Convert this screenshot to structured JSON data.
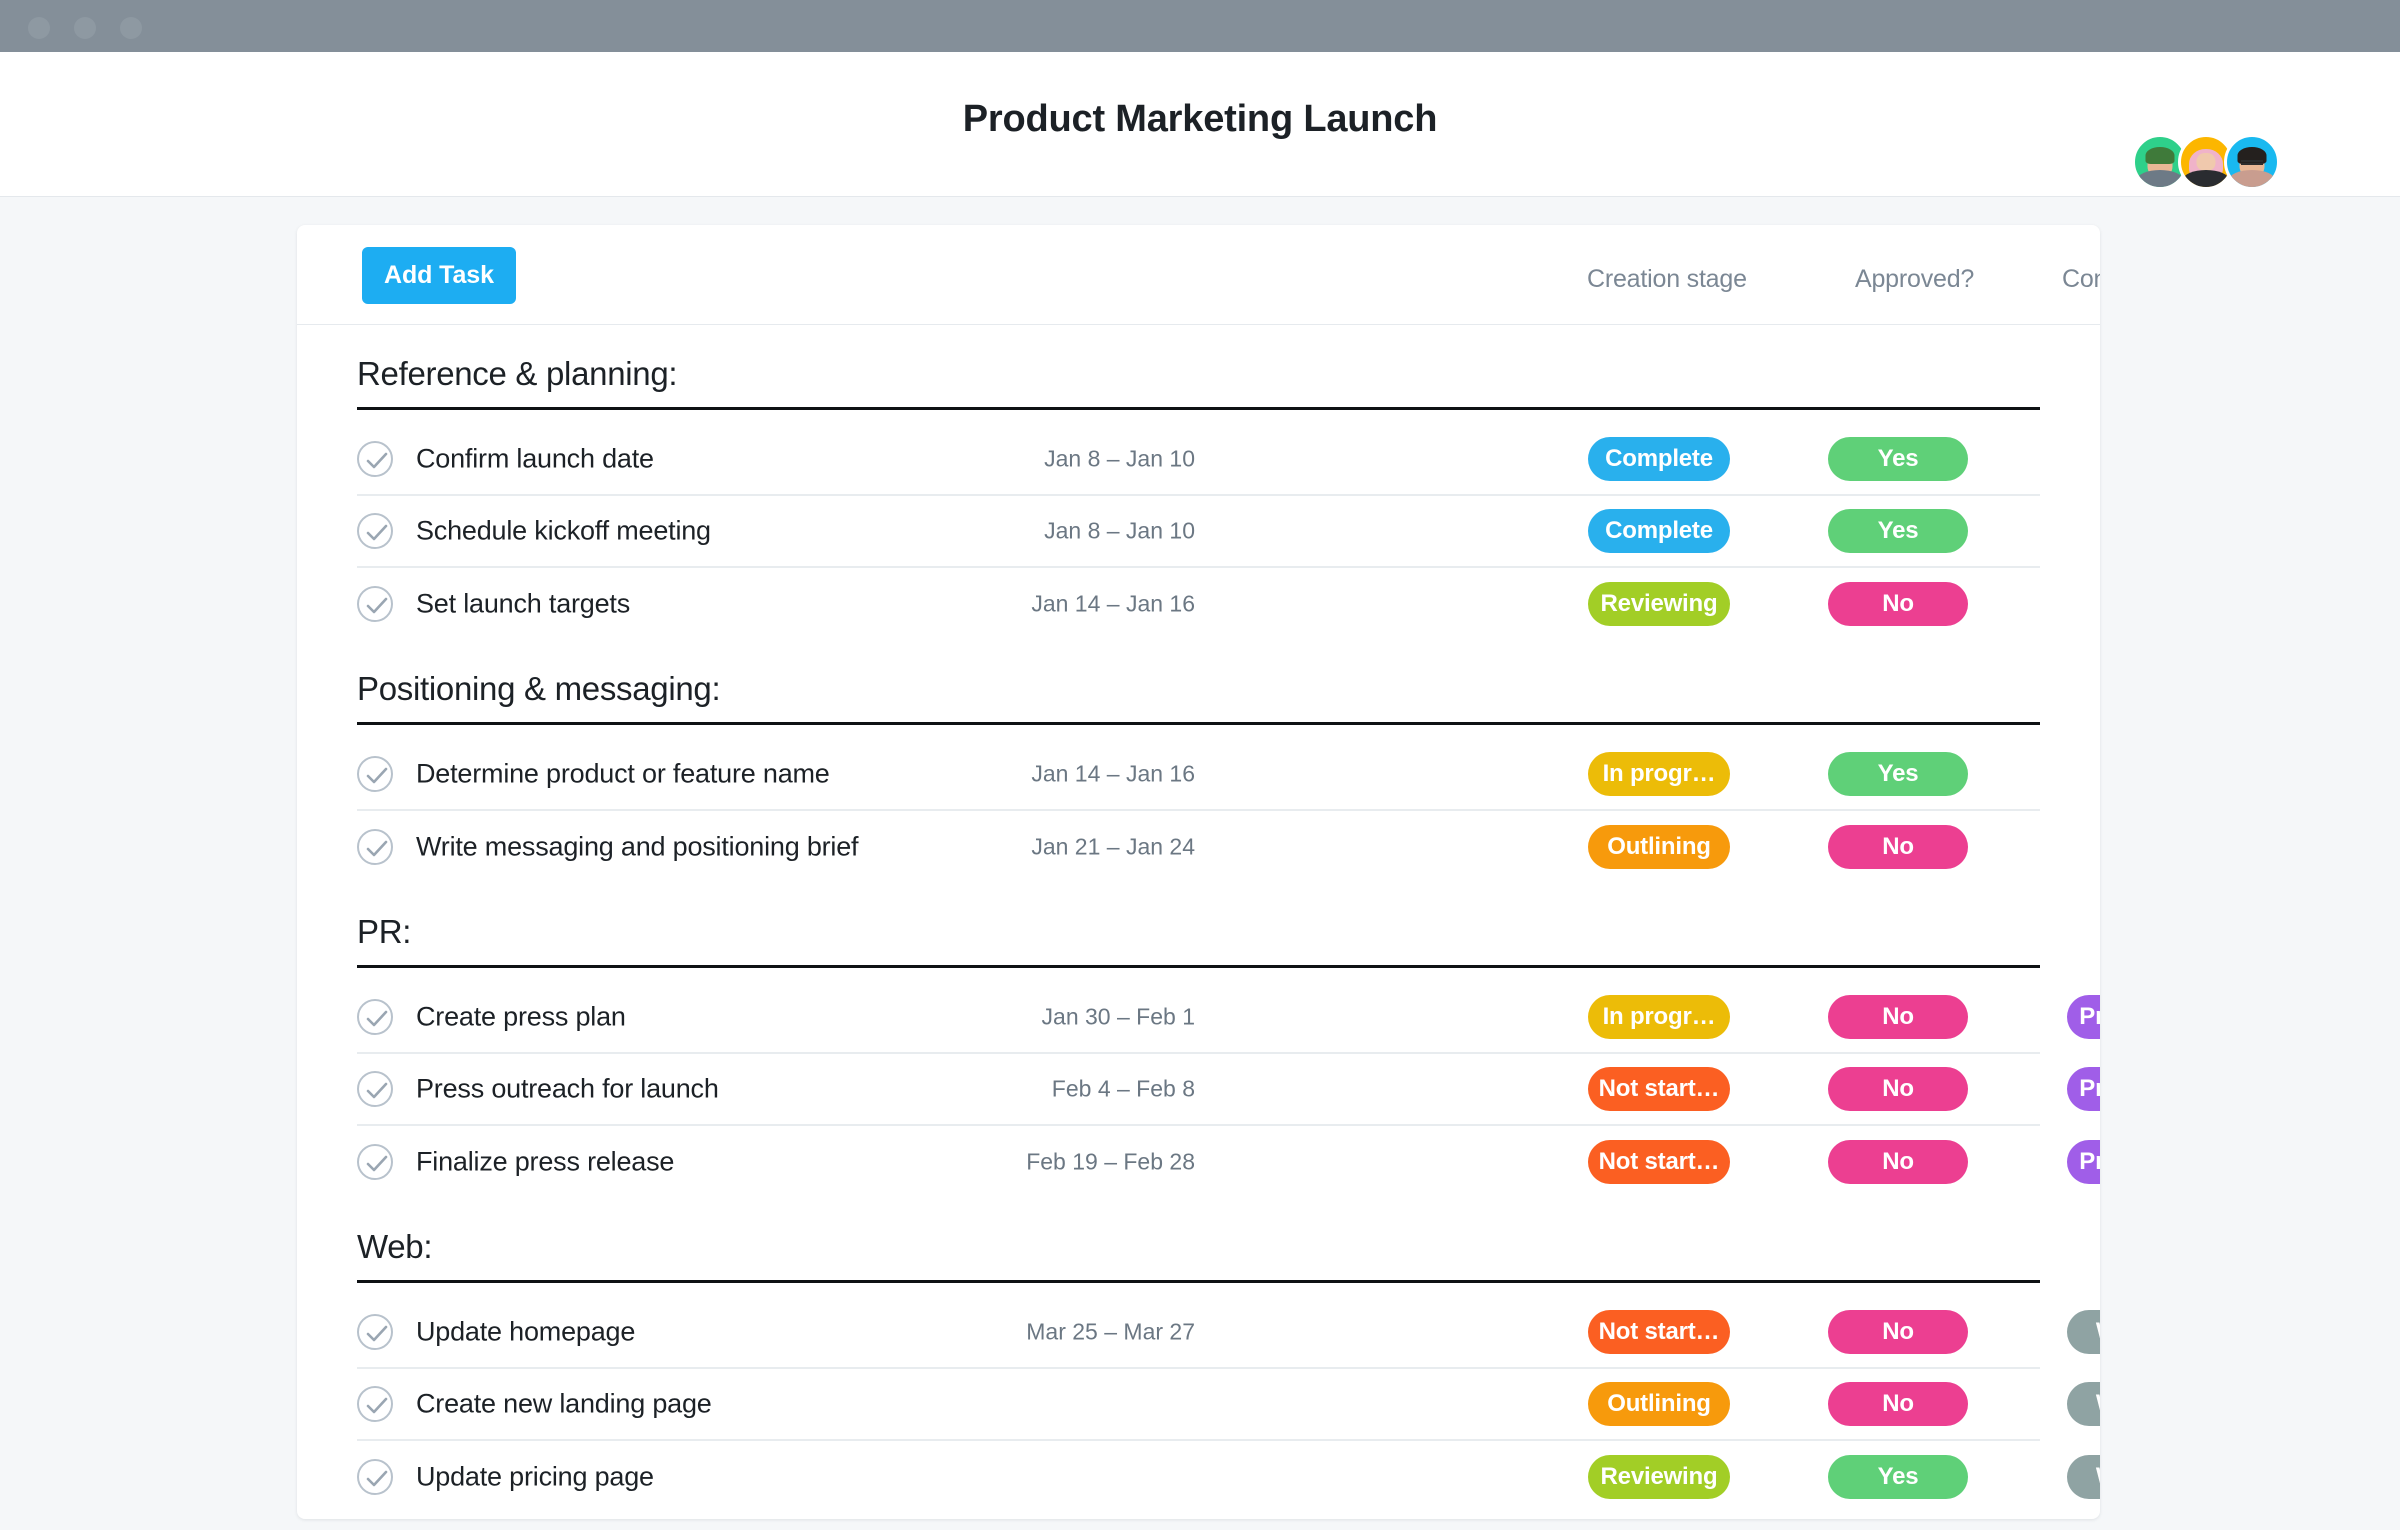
{
  "window": {
    "traffic_lights": [
      "close",
      "minimize",
      "maximize"
    ]
  },
  "header": {
    "title": "Product Marketing Launch",
    "avatars": [
      {
        "name": "team-member-green",
        "color": "#2ed08a",
        "tone": "green"
      },
      {
        "name": "team-member-yellow",
        "color": "#fcb600",
        "tone": "yellow"
      },
      {
        "name": "team-member-blue",
        "color": "#19b9f0",
        "tone": "blue"
      }
    ]
  },
  "toolbar": {
    "add_task_label": "Add Task",
    "columns": [
      {
        "key": "stage",
        "label": "Creation stage"
      },
      {
        "key": "approved",
        "label": "Approved?"
      },
      {
        "key": "channel",
        "label": "Content channel"
      }
    ]
  },
  "colors": {
    "accent": "#1dadf2",
    "complete": "#29b0ed",
    "reviewing": "#a2ce26",
    "in_progress": "#ecbc08",
    "outlining": "#f79a0c",
    "not_started": "#fb5f22",
    "yes": "#5fd078",
    "no": "#ec3f91",
    "press_release": "#a05ee8",
    "website": "#8fa3a3",
    "section_rule": "#0e1114",
    "window_bar": "#848f99"
  },
  "sections": [
    {
      "title": "Reference & planning:",
      "tasks": [
        {
          "name": "Confirm launch date",
          "dates": "Jan 8 – Jan 10",
          "stage": {
            "label": "Complete",
            "color": "#29b0ed"
          },
          "approved": {
            "label": "Yes",
            "color": "#5fd078"
          },
          "channel": null,
          "avatar": "yellow"
        },
        {
          "name": "Schedule kickoff meeting",
          "dates": "Jan 8 – Jan 10",
          "stage": {
            "label": "Complete",
            "color": "#29b0ed"
          },
          "approved": {
            "label": "Yes",
            "color": "#5fd078"
          },
          "channel": null,
          "avatar": "yellow"
        },
        {
          "name": "Set launch targets",
          "dates": "Jan 14 – Jan 16",
          "stage": {
            "label": "Reviewing",
            "color": "#a2ce26"
          },
          "approved": {
            "label": "No",
            "color": "#ec3f91"
          },
          "channel": null,
          "avatar": "yellow"
        }
      ]
    },
    {
      "title": "Positioning & messaging:",
      "tasks": [
        {
          "name": "Determine product or feature name",
          "dates": "Jan 14 – Jan 16",
          "stage": {
            "label": "In progr…",
            "color": "#ecbc08"
          },
          "approved": {
            "label": "Yes",
            "color": "#5fd078"
          },
          "channel": null,
          "avatar": "green"
        },
        {
          "name": "Write messaging and positioning brief",
          "dates": "Jan 21 – Jan 24",
          "stage": {
            "label": "Outlining",
            "color": "#f79a0c"
          },
          "approved": {
            "label": "No",
            "color": "#ec3f91"
          },
          "channel": null,
          "avatar": "green"
        }
      ]
    },
    {
      "title": "PR:",
      "tasks": [
        {
          "name": "Create press plan",
          "dates": "Jan 30 – Feb 1",
          "stage": {
            "label": "In progr…",
            "color": "#ecbc08"
          },
          "approved": {
            "label": "No",
            "color": "#ec3f91"
          },
          "channel": {
            "label": "Press rel…",
            "color": "#a05ee8"
          },
          "avatar": "green"
        },
        {
          "name": "Press outreach for launch",
          "dates": "Feb 4 – Feb 8",
          "stage": {
            "label": "Not start…",
            "color": "#fb5f22"
          },
          "approved": {
            "label": "No",
            "color": "#ec3f91"
          },
          "channel": {
            "label": "Press rel…",
            "color": "#a05ee8"
          },
          "avatar": "green"
        },
        {
          "name": "Finalize press release",
          "dates": "Feb 19 – Feb 28",
          "stage": {
            "label": "Not start…",
            "color": "#fb5f22"
          },
          "approved": {
            "label": "No",
            "color": "#ec3f91"
          },
          "channel": {
            "label": "Press rel…",
            "color": "#a05ee8"
          },
          "avatar": "yellow"
        }
      ]
    },
    {
      "title": "Web:",
      "tasks": [
        {
          "name": "Update homepage",
          "dates": "Mar 25 – Mar 27",
          "stage": {
            "label": "Not start…",
            "color": "#fb5f22"
          },
          "approved": {
            "label": "No",
            "color": "#ec3f91"
          },
          "channel": {
            "label": "Website",
            "color": "#8fa3a3"
          },
          "avatar": "green"
        },
        {
          "name": "Create new landing page",
          "dates": "",
          "stage": {
            "label": "Outlining",
            "color": "#f79a0c"
          },
          "approved": {
            "label": "No",
            "color": "#ec3f91"
          },
          "channel": {
            "label": "Website",
            "color": "#8fa3a3"
          },
          "avatar": "green"
        },
        {
          "name": "Update pricing page",
          "dates": "",
          "stage": {
            "label": "Reviewing",
            "color": "#a2ce26"
          },
          "approved": {
            "label": "Yes",
            "color": "#5fd078"
          },
          "channel": {
            "label": "Website",
            "color": "#8fa3a3"
          },
          "avatar": "yellow"
        }
      ]
    }
  ]
}
